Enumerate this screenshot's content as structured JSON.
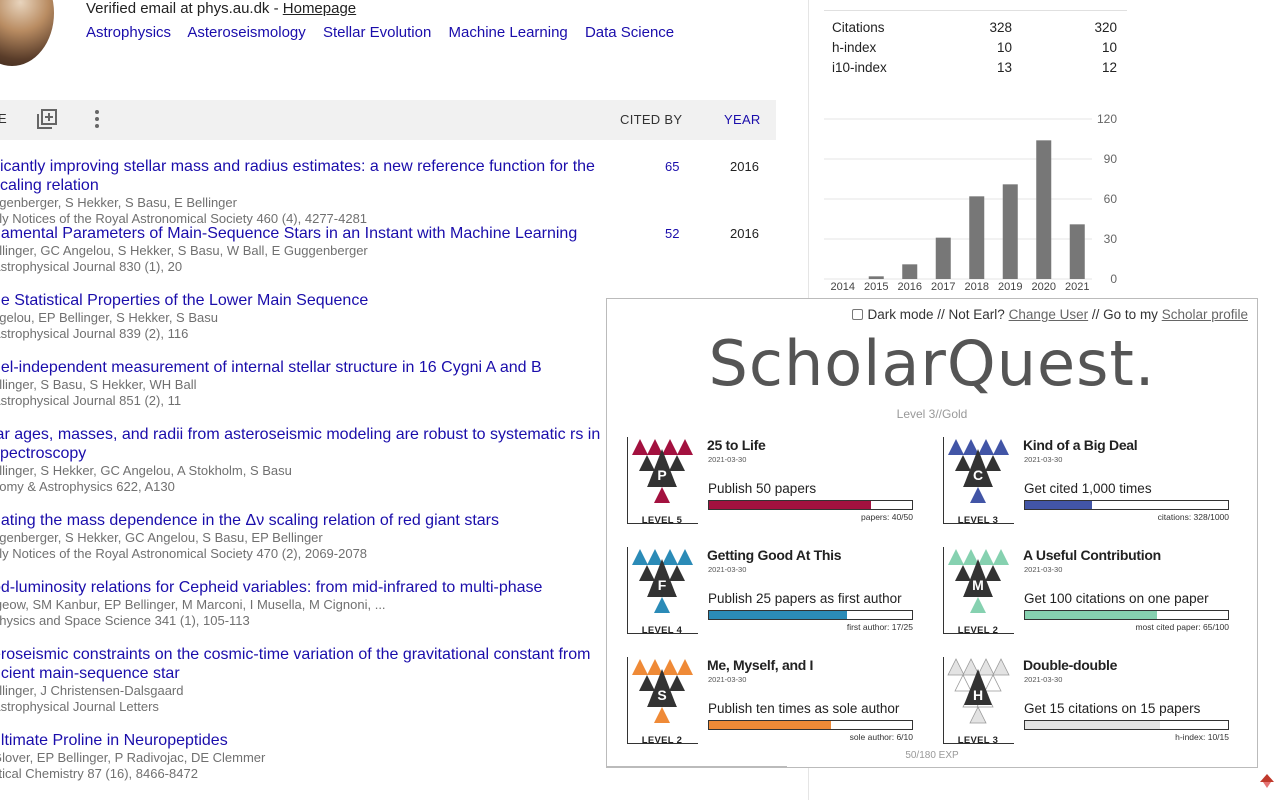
{
  "profile": {
    "email_text": "Verified email at phys.au.dk - ",
    "homepage_link": "Homepage",
    "interests": [
      "Astrophysics",
      "Asteroseismology",
      "Stellar Evolution",
      "Machine Learning",
      "Data Science"
    ]
  },
  "toolbar": {
    "cited_by_label": "CITED BY",
    "year_label": "YEAR",
    "truncated_label": "E"
  },
  "articles": [
    {
      "title": "ificantly improving stellar mass and radius estimates: a new reference function for the scaling relation",
      "authors": "ggenberger, S Hekker, S Basu, E Bellinger",
      "venue": "hly Notices of the Royal Astronomical Society 460 (4), 4277-4281",
      "cited_by": "65",
      "year": "2016"
    },
    {
      "title": "damental Parameters of Main-Sequence Stars in an Instant with Machine Learning",
      "authors": "ellinger, GC Angelou, S Hekker, S Basu, W Ball, E Guggenberger",
      "venue": "Astrophysical Journal 830 (1), 20",
      "cited_by": "52",
      "year": "2016"
    },
    {
      "title": "he Statistical Properties of the Lower Main Sequence",
      "authors": "ngelou, EP Bellinger, S Hekker, S Basu",
      "venue": "Astrophysical Journal 839 (2), 116",
      "cited_by": "",
      "year": ""
    },
    {
      "title": "del-independent measurement of internal stellar structure in 16 Cygni A and B",
      "authors": "ellinger, S Basu, S Hekker, WH Ball",
      "venue": "Astrophysical Journal 851 (2), 11",
      "cited_by": "",
      "year": ""
    },
    {
      "title": "lar ages, masses, and radii from asteroseismic modeling are robust to systematic rs in spectroscopy",
      "authors": "ellinger, S Hekker, GC Angelou, A Stokholm, S Basu",
      "venue": "nomy & Astrophysics 622, A130",
      "cited_by": "",
      "year": ""
    },
    {
      "title": "gating the mass dependence in the Δν scaling relation of red giant stars",
      "authors": "ggenberger, S Hekker, GC Angelou, S Basu, EP Bellinger",
      "venue": "hly Notices of the Royal Astronomical Society 470 (2), 2069-2078",
      "cited_by": "",
      "year": ""
    },
    {
      "title": "od-luminosity relations for Cepheid variables: from mid-infrared to multi-phase",
      "authors": "lgeow, SM Kanbur, EP Bellinger, M Marconi, I Musella, M Cignoni, ...",
      "venue": "physics and Space Science 341 (1), 105-113",
      "cited_by": "",
      "year": ""
    },
    {
      "title": "eroseismic constraints on the cosmic-time variation of the gravitational constant from ncient main-sequence star",
      "authors": "ellinger, J Christensen-Dalsgaard",
      "venue": "Astrophysical Journal Letters",
      "cited_by": "",
      "year": ""
    },
    {
      "title": "ultimate Proline in Neuropeptides",
      "authors": "Glover, EP Bellinger, P Radivojac, DE Clemmer",
      "venue": "ytical Chemistry 87 (16), 8466-8472",
      "cited_by": "",
      "year": ""
    }
  ],
  "stats": {
    "rows": [
      {
        "label": "Citations",
        "all": "328",
        "since": "320"
      },
      {
        "label": "h-index",
        "all": "10",
        "since": "10"
      },
      {
        "label": "i10-index",
        "all": "13",
        "since": "12"
      }
    ]
  },
  "chart_data": {
    "type": "bar",
    "categories": [
      "2014",
      "2015",
      "2016",
      "2017",
      "2018",
      "2019",
      "2020",
      "2021"
    ],
    "values": [
      0,
      2,
      11,
      31,
      62,
      71,
      104,
      41
    ],
    "title": "",
    "xlabel": "",
    "ylabel": "",
    "ylim": [
      0,
      120
    ],
    "yticks": [
      "0",
      "30",
      "60",
      "90",
      "120"
    ],
    "bar_color": "#777777",
    "grid": true
  },
  "scholarquest": {
    "dark_mode_label": "Dark mode",
    "sep1": "//",
    "not_user_text": "Not Earl?",
    "change_user_link": "Change User",
    "sep2": "//",
    "goto_text": "Go to my",
    "profile_link": "Scholar profile",
    "logo": "ScholarQuest.",
    "level_text": "Level 3//Gold",
    "exp_text": "50/180 EXP",
    "achievements": [
      {
        "letter": "P",
        "title": "25 to Life",
        "date": "2021-03-30",
        "desc": "Publish 50 papers",
        "level": "LEVEL 5",
        "progress_label": "papers: 40/50",
        "progress": 0.8,
        "color": "#a3113f"
      },
      {
        "letter": "C",
        "title": "Kind of a Big Deal",
        "date": "2021-03-30",
        "desc": "Get cited 1,000 times",
        "level": "LEVEL 3",
        "progress_label": "citations: 328/1000",
        "progress": 0.328,
        "color": "#4255a6"
      },
      {
        "letter": "F",
        "title": "Getting Good At This",
        "date": "2021-03-30",
        "desc": "Publish 25 papers as first author",
        "level": "LEVEL 4",
        "progress_label": "first author: 17/25",
        "progress": 0.68,
        "color": "#2b8bb7"
      },
      {
        "letter": "M",
        "title": "A Useful Contribution",
        "date": "2021-03-30",
        "desc": "Get 100 citations on one paper",
        "level": "LEVEL 2",
        "progress_label": "most cited paper: 65/100",
        "progress": 0.65,
        "color": "#86d1b0"
      },
      {
        "letter": "S",
        "title": "Me, Myself, and I",
        "date": "2021-03-30",
        "desc": "Publish ten times as sole author",
        "level": "LEVEL 2",
        "progress_label": "sole author: 6/10",
        "progress": 0.6,
        "color": "#ef8a37"
      },
      {
        "letter": "H",
        "title": "Double-double",
        "date": "2021-03-30",
        "desc": "Get 15 citations on 15 papers",
        "level": "LEVEL 3",
        "progress_label": "h-index: 10/15",
        "progress": 0.667,
        "color": "#e3e3e3"
      }
    ]
  },
  "icons": {
    "add_to_library": "add-box-icon",
    "more": "more-vert-icon",
    "corner": "scholarquest-icon"
  }
}
